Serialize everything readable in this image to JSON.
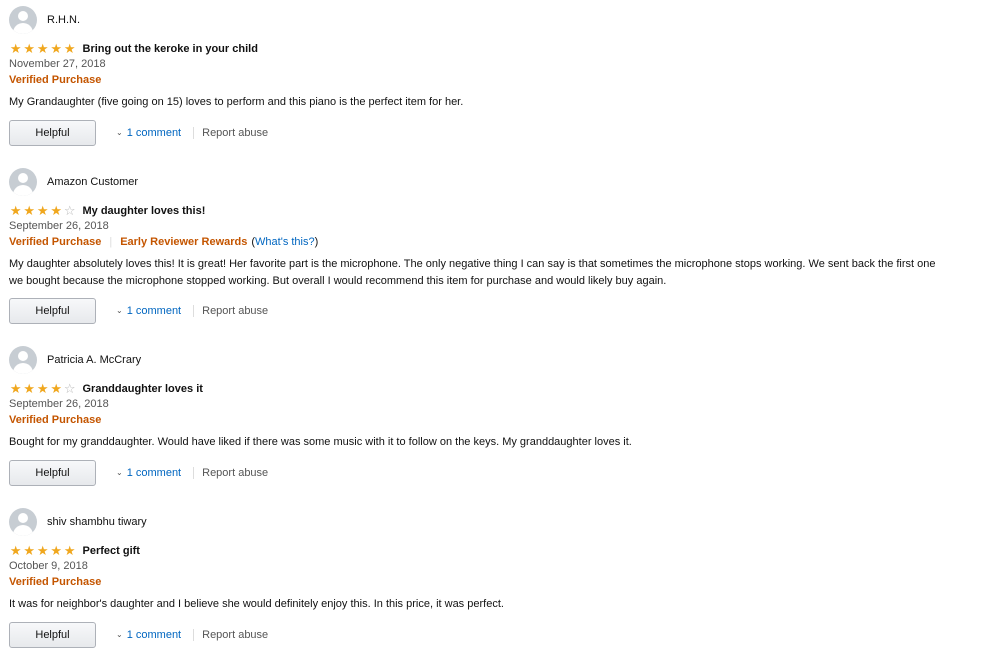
{
  "reviews": [
    {
      "reviewer": "R.H.N.",
      "rating": 5,
      "title": "Bring out the keroke in your child",
      "date": "November 27, 2018",
      "verified": "Verified Purchase",
      "body": "My Grandaughter (five going on 15) loves to perform and this piano is the perfect item for her.",
      "helpful": "Helpful",
      "comments": "1 comment",
      "report": "Report abuse"
    },
    {
      "reviewer": "Amazon Customer",
      "rating": 4,
      "title": "My daughter loves this!",
      "date": "September 26, 2018",
      "verified": "Verified Purchase",
      "early_reviewer": "Early Reviewer Rewards",
      "whats_this": "What's this?",
      "body": "My daughter absolutely loves this! It is great! Her favorite part is the microphone. The only negative thing I can say is that sometimes the microphone stops working. We sent back the first one we bought because the microphone stopped working. But overall I would recommend this item for purchase and would likely buy again.",
      "helpful": "Helpful",
      "comments": "1 comment",
      "report": "Report abuse"
    },
    {
      "reviewer": "Patricia A. McCrary",
      "rating": 4,
      "title": "Granddaughter loves it",
      "date": "September 26, 2018",
      "verified": "Verified Purchase",
      "body": "Bought for my granddaughter. Would have liked if there was some music with it to follow on the keys. My granddaughter loves it.",
      "helpful": "Helpful",
      "comments": "1 comment",
      "report": "Report abuse"
    },
    {
      "reviewer": "shiv shambhu tiwary",
      "rating": 5,
      "title": "Perfect gift",
      "date": "October 9, 2018",
      "verified": "Verified Purchase",
      "body": "It was for neighbor's daughter and I believe she would definitely enjoy this. In this price, it was perfect.",
      "helpful": "Helpful",
      "comments": "1 comment",
      "report": "Report abuse"
    }
  ],
  "colors": {
    "star": "#f0a71e",
    "verified": "#c45500",
    "link": "#0066c0"
  },
  "icons": {
    "avatar": "user-avatar-icon",
    "star_filled": "star-filled-icon",
    "star_empty": "star-empty-icon",
    "chevron": "chevron-down-icon"
  }
}
